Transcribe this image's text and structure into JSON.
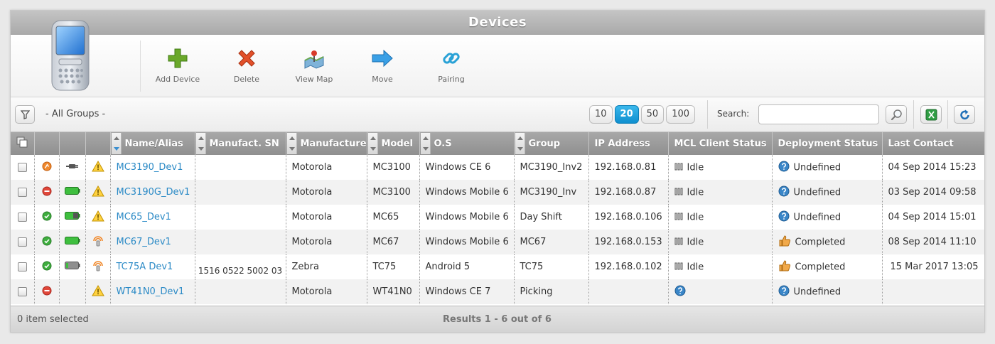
{
  "title": "Devices",
  "toolbar": {
    "buttons": [
      {
        "label": "Add Device",
        "icon": "plus-icon"
      },
      {
        "label": "Delete",
        "icon": "x-icon"
      },
      {
        "label": "View Map",
        "icon": "map-icon"
      },
      {
        "label": "Move",
        "icon": "arrow-right-icon"
      },
      {
        "label": "Pairing",
        "icon": "link-icon"
      }
    ]
  },
  "filter": {
    "group_label": "- All Groups -",
    "page_sizes": [
      "10",
      "20",
      "50",
      "100"
    ],
    "active_page_size": "20",
    "search_label": "Search:",
    "search_value": ""
  },
  "table": {
    "columns": [
      "Name/Alias",
      "Manufact. SN",
      "Manufacturer",
      "Model",
      "O.S",
      "Group",
      "IP Address",
      "MCL Client Status",
      "Deployment Status",
      "Last Contact"
    ],
    "rows": [
      {
        "state": "orange",
        "power": "plug",
        "warn": "warning",
        "name": "MC3190_Dev1",
        "sn": "",
        "manufacturer": "Motorola",
        "model": "MC3100",
        "os": "Windows CE 6",
        "group": "MC3190_Inv2",
        "ip": "192.168.0.81",
        "mcl": "Idle",
        "mcl_icon": "bars",
        "deploy": "Undefined",
        "deploy_icon": "question",
        "last": "04 Sep 2014 15:23"
      },
      {
        "state": "red",
        "power": "battery-full",
        "warn": "warning",
        "name": "MC3190G_Dev1",
        "sn": "",
        "manufacturer": "Motorola",
        "model": "MC3100",
        "os": "Windows Mobile 6",
        "group": "MC3190_Inv",
        "ip": "192.168.0.87",
        "mcl": "Idle",
        "mcl_icon": "bars",
        "deploy": "Undefined",
        "deploy_icon": "question",
        "last": "03 Sep 2014 09:58"
      },
      {
        "state": "green",
        "power": "battery-charge",
        "warn": "warning",
        "name": "MC65_Dev1",
        "sn": "",
        "manufacturer": "Motorola",
        "model": "MC65",
        "os": "Windows Mobile 6",
        "group": "Day Shift",
        "ip": "192.168.0.106",
        "mcl": "Idle",
        "mcl_icon": "bars",
        "deploy": "Undefined",
        "deploy_icon": "question",
        "last": "04 Sep 2014 15:01"
      },
      {
        "state": "green",
        "power": "battery-full",
        "warn": "signal",
        "name": "MC67_Dev1",
        "sn": "",
        "manufacturer": "Motorola",
        "model": "MC67",
        "os": "Windows Mobile 6",
        "group": "MC67",
        "ip": "192.168.0.153",
        "mcl": "Idle",
        "mcl_icon": "bars",
        "deploy": "Completed",
        "deploy_icon": "thumb",
        "last": "08 Sep 2014 11:10"
      },
      {
        "state": "green",
        "power": "battery-empty",
        "warn": "signal",
        "name": "TC75A Dev1",
        "sn": "1516 0522 5002 03",
        "manufacturer": "Zebra",
        "model": "TC75",
        "os": "Android 5",
        "group": "TC75",
        "ip": "192.168.0.102",
        "mcl": "Idle",
        "mcl_icon": "bars",
        "deploy": "Completed",
        "deploy_icon": "thumb",
        "last": "15 Mar 2017 13:05"
      },
      {
        "state": "red",
        "power": "",
        "warn": "warning",
        "name": "WT41N0_Dev1",
        "sn": "",
        "manufacturer": "Motorola",
        "model": "WT41N0",
        "os": "Windows CE 7",
        "group": "Picking",
        "ip": "",
        "mcl": "",
        "mcl_icon": "question",
        "deploy": "Undefined",
        "deploy_icon": "question",
        "last": ""
      }
    ]
  },
  "footer": {
    "selected": "0 item selected",
    "results": "Results 1 - 6 out of 6"
  },
  "colors": {
    "accent": "#1a9ad6",
    "link": "#2b8ac6",
    "ok": "#3fae3f",
    "error": "#e0473a",
    "warning": "#f0b400"
  }
}
